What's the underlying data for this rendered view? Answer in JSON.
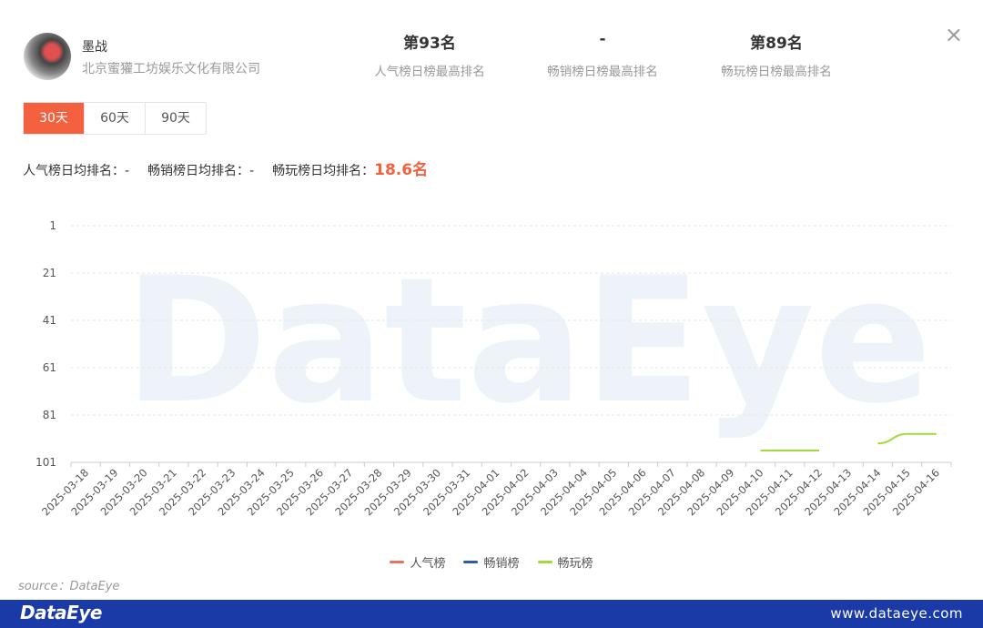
{
  "header": {
    "game_name": "墨战",
    "company": "北京蜜獾工坊娱乐文化有限公司",
    "stats": [
      {
        "value": "第93名",
        "label": "人气榜日榜最高排名"
      },
      {
        "value": "-",
        "label": "畅销榜日榜最高排名"
      },
      {
        "value": "第89名",
        "label": "畅玩榜日榜最高排名"
      }
    ],
    "close_icon": "×"
  },
  "tabs": [
    {
      "label": "30天",
      "active": true
    },
    {
      "label": "60天",
      "active": false
    },
    {
      "label": "90天",
      "active": false
    }
  ],
  "averages": {
    "popular_label": "人气榜日均排名：",
    "popular_value": "-",
    "bestseller_label": "畅销榜日均排名：",
    "bestseller_value": "-",
    "play_label": "畅玩榜日均排名：",
    "play_value": "18.6名"
  },
  "watermark": "DataEye",
  "chart_data": {
    "type": "line",
    "x": [
      "2025-03-18",
      "2025-03-19",
      "2025-03-20",
      "2025-03-21",
      "2025-03-22",
      "2025-03-23",
      "2025-03-24",
      "2025-03-25",
      "2025-03-26",
      "2025-03-27",
      "2025-03-28",
      "2025-03-29",
      "2025-03-30",
      "2025-03-31",
      "2025-04-01",
      "2025-04-02",
      "2025-04-03",
      "2025-04-04",
      "2025-04-05",
      "2025-04-06",
      "2025-04-07",
      "2025-04-08",
      "2025-04-09",
      "2025-04-10",
      "2025-04-11",
      "2025-04-12",
      "2025-04-13",
      "2025-04-14",
      "2025-04-15",
      "2025-04-16"
    ],
    "y_ticks": [
      1,
      21,
      41,
      61,
      81,
      101
    ],
    "ylim": [
      1,
      101
    ],
    "y_inverted": true,
    "series": [
      {
        "name": "人气榜",
        "color": "#e8735a",
        "values": [
          null,
          null,
          null,
          null,
          null,
          null,
          null,
          null,
          null,
          null,
          null,
          null,
          null,
          null,
          null,
          null,
          null,
          null,
          null,
          null,
          null,
          null,
          null,
          null,
          null,
          null,
          null,
          null,
          null,
          null
        ]
      },
      {
        "name": "畅销榜",
        "color": "#2f5aa8",
        "values": [
          null,
          null,
          null,
          null,
          null,
          null,
          null,
          null,
          null,
          null,
          null,
          null,
          null,
          null,
          null,
          null,
          null,
          null,
          null,
          null,
          null,
          null,
          null,
          null,
          null,
          null,
          null,
          null,
          null,
          null
        ]
      },
      {
        "name": "畅玩榜",
        "color": "#a3d93a",
        "values": [
          null,
          null,
          null,
          null,
          null,
          null,
          null,
          null,
          null,
          null,
          null,
          null,
          null,
          null,
          null,
          null,
          null,
          null,
          null,
          null,
          null,
          null,
          null,
          96,
          96,
          96,
          null,
          93,
          89,
          89
        ]
      }
    ]
  },
  "source": "source：DataEye",
  "footer": {
    "brand": "DataEye",
    "url": "www.dataeye.com"
  }
}
